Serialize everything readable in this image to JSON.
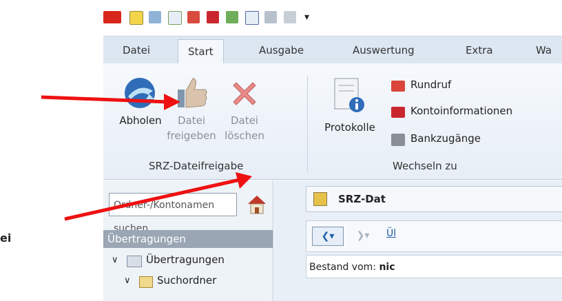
{
  "ribbon_tabs": [
    "Datei",
    "Start",
    "Ausgabe",
    "Auswertung",
    "Extra",
    "Wa"
  ],
  "ribbon": {
    "abholen": "Abholen",
    "datei_freigeben": [
      "Datei",
      "freigeben"
    ],
    "datei_loeschen": [
      "Datei",
      "löschen"
    ],
    "protokolle": "Protokolle",
    "group1_label": "SRZ-Dateifreigabe",
    "rundruf": "Rundruf",
    "kontoinformationen": "Kontoinformationen",
    "bankzugaenge": "Bankzugänge",
    "group2_label": "Wechseln zu"
  },
  "leftpanel": {
    "search_placeholder": "Ordner-/Kontonamen suchen",
    "header": "Übertragungen",
    "tree": [
      "Übertragungen",
      "Suchordner"
    ]
  },
  "rightpane": {
    "doc_tab": "SRZ-Dat",
    "nav_link": "Ül",
    "bestand_label": "Bestand vom:",
    "bestand_value": "nic"
  },
  "margin_text": "ei"
}
